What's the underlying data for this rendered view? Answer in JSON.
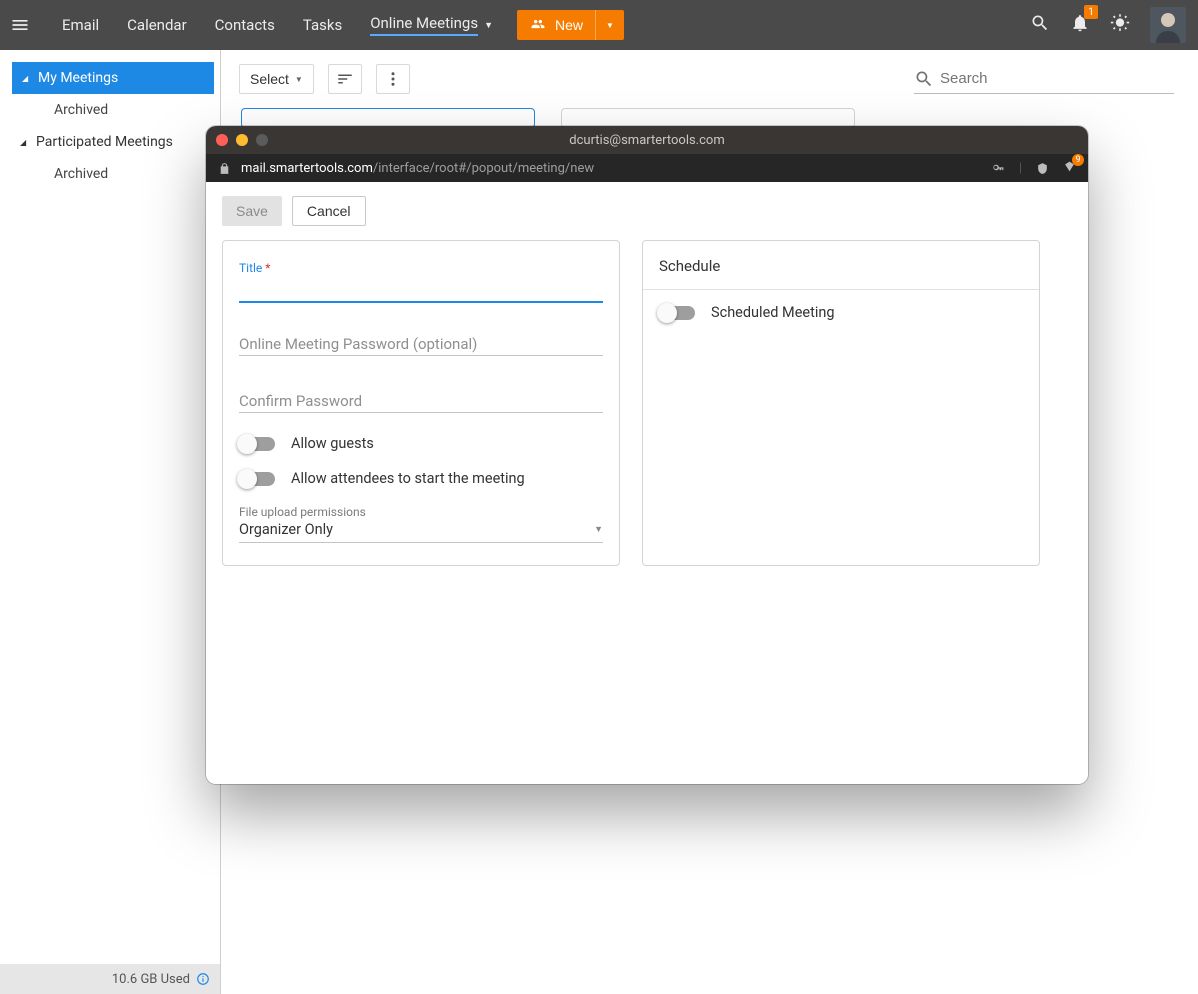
{
  "topbar": {
    "nav": [
      "Email",
      "Calendar",
      "Contacts",
      "Tasks",
      "Online Meetings"
    ],
    "active_index": 4,
    "new_label": "New",
    "notif_count": "1"
  },
  "sidebar": {
    "items": [
      {
        "label": "My Meetings",
        "type": "root",
        "active": true
      },
      {
        "label": "Archived",
        "type": "child"
      },
      {
        "label": "Participated Meetings",
        "type": "root"
      },
      {
        "label": "Archived",
        "type": "child"
      }
    ],
    "storage": "10.6 GB Used"
  },
  "toolbar": {
    "select_label": "Select",
    "search_placeholder": "Search"
  },
  "popup": {
    "window_title": "dcurtis@smartertools.com",
    "url_domain": "mail.smartertools.com",
    "url_path": "/interface/root#/popout/meeting/new",
    "shield_count": "9",
    "save_label": "Save",
    "cancel_label": "Cancel",
    "title_field_label": "Title",
    "title_required": "*",
    "password_placeholder": "Online Meeting Password (optional)",
    "confirm_placeholder": "Confirm Password",
    "allow_guests_label": "Allow guests",
    "allow_attendees_label": "Allow attendees to start the meeting",
    "upload_perm_label": "File upload permissions",
    "upload_perm_value": "Organizer Only",
    "schedule_header": "Schedule",
    "scheduled_toggle_label": "Scheduled Meeting"
  }
}
